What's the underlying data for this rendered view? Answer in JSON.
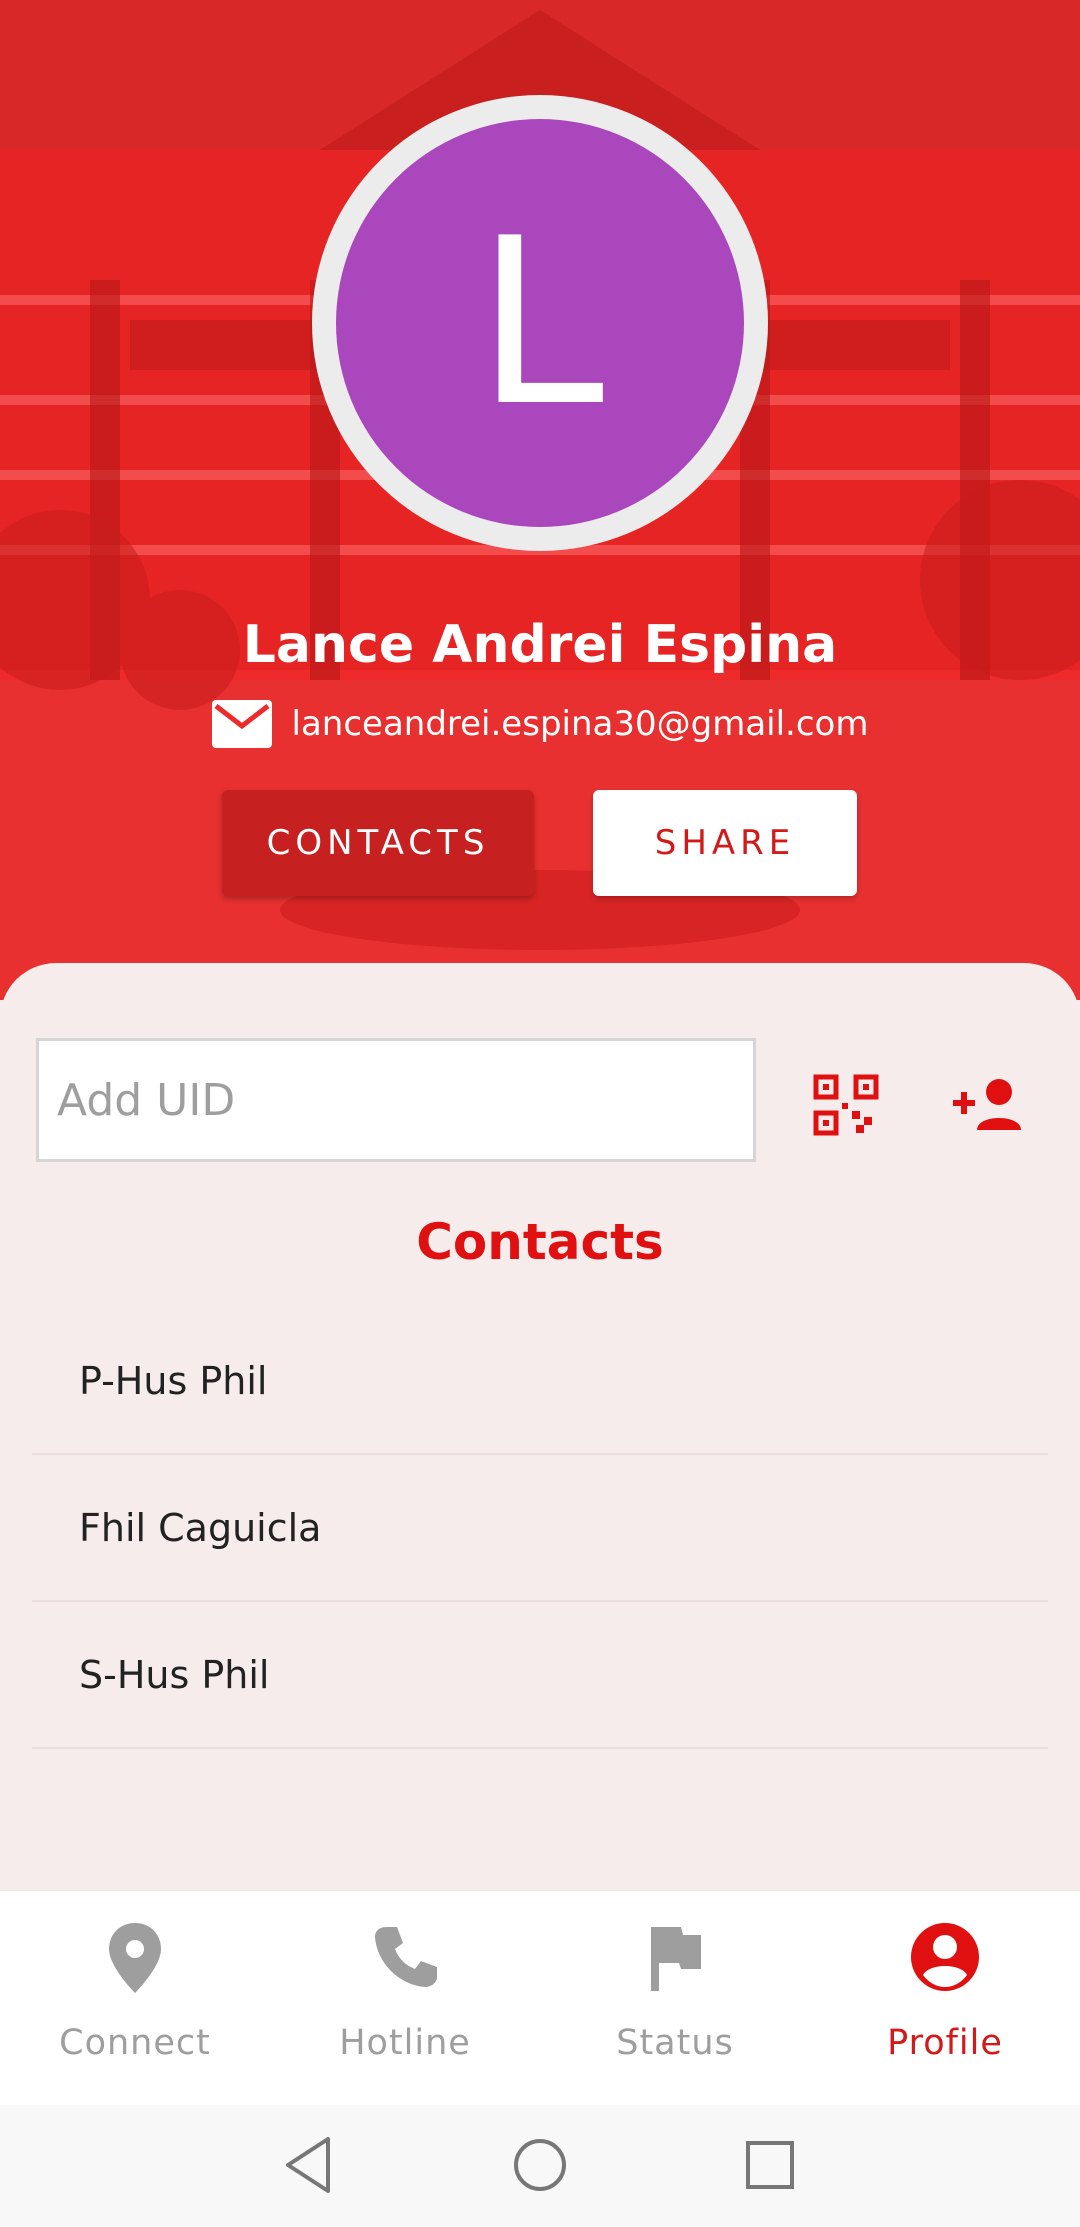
{
  "profile": {
    "avatar_initial": "L",
    "name": "Lance Andrei Espina",
    "email": "lanceandrei.espina30@gmail.com",
    "contacts_button": "CONTACTS",
    "share_button": "SHARE"
  },
  "add_uid": {
    "placeholder": "Add UID"
  },
  "contacts": {
    "title": "Contacts",
    "items": [
      "P-Hus Phil",
      "Fhil Caguicla",
      "S-Hus Phil"
    ]
  },
  "nav": {
    "items": [
      {
        "label": "Connect",
        "icon": "location-pin-icon",
        "active": false
      },
      {
        "label": "Hotline",
        "icon": "phone-icon",
        "active": false
      },
      {
        "label": "Status",
        "icon": "flag-icon",
        "active": false
      },
      {
        "label": "Profile",
        "icon": "account-circle-icon",
        "active": true
      }
    ]
  },
  "colors": {
    "header_red": "#ee2a2a",
    "accent_red": "#d31a1a",
    "avatar_purple": "#ab47bc",
    "panel_bg": "#f7ecec",
    "inactive_gray": "#9e9e9e"
  }
}
